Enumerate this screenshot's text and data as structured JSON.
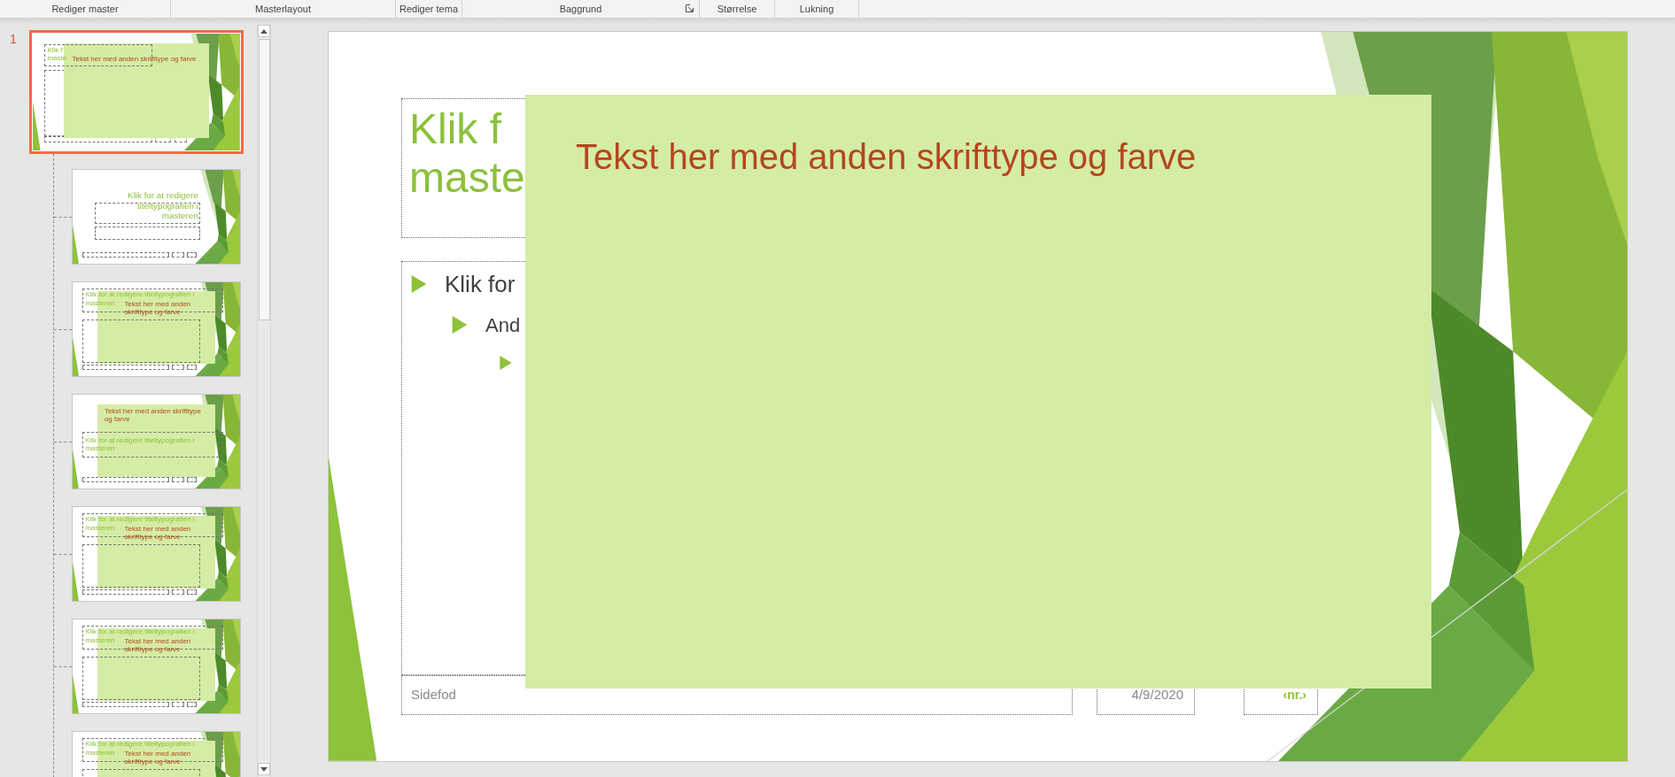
{
  "ribbon_groups": [
    {
      "label": "Rediger master",
      "launcher": false
    },
    {
      "label": "Masterlayout",
      "launcher": false
    },
    {
      "label": "Rediger tema",
      "launcher": false
    },
    {
      "label": "Baggrund",
      "launcher": true
    },
    {
      "label": "Størrelse",
      "launcher": false
    },
    {
      "label": "Lukning",
      "launcher": false
    }
  ],
  "thumbnails": [
    {
      "number": "1",
      "kind": "master",
      "selected": true,
      "title_lines": [
        "Klik f",
        "maste"
      ],
      "overlay_text": "Tekst her med anden skrifttype og farve"
    },
    {
      "kind": "title",
      "selected": false,
      "title_lines": [
        "Klik for at redigere",
        "titeltypografien i",
        "masteren"
      ]
    },
    {
      "kind": "content",
      "selected": false,
      "title_lines": [
        "Klik for at redigere titeltypografien i",
        "masteren"
      ],
      "overlay_text": "Tekst her med anden skrifttype og farve"
    },
    {
      "kind": "section",
      "selected": false,
      "title_lines": [
        "Klik for at redigere titeltypografien i",
        "masteren"
      ],
      "overlay_text": "Tekst her med anden skrifttype og farve"
    },
    {
      "kind": "content",
      "selected": false,
      "title_lines": [
        "Klik for at redigere titeltypografien i",
        "masteren"
      ],
      "overlay_text": "Tekst her med anden skrifttype og farve"
    },
    {
      "kind": "content",
      "selected": false,
      "title_lines": [
        "Klik for at redigere titeltypografien i",
        "masteren"
      ],
      "overlay_text": "Tekst her med anden skrifttype og farve"
    },
    {
      "kind": "content",
      "selected": false,
      "title_lines": [
        "Klik for at redigere titeltypografien i",
        "masteren"
      ],
      "overlay_text": "Tekst her med anden skrifttype og farve"
    }
  ],
  "slide": {
    "title_lines": [
      "Klik f",
      "maste"
    ],
    "body": [
      {
        "kind": "text",
        "text": "Klik for",
        "children": [
          {
            "kind": "text",
            "text": "And",
            "children": [
              {
                "kind": "bullet"
              }
            ]
          }
        ]
      }
    ],
    "overlay_text": "Tekst her med anden skrifttype og farve",
    "footer": "Sidefod",
    "date": "4/9/2020",
    "number": "‹nr.›"
  }
}
